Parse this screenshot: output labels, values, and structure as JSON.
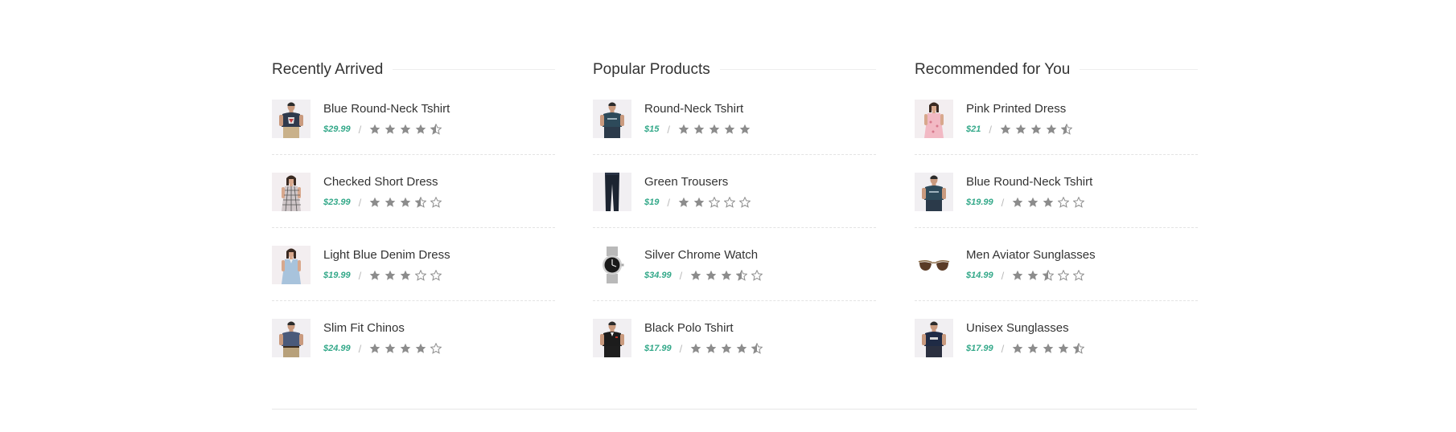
{
  "colors": {
    "accent": "#35a98a",
    "star": "#8c8c8c",
    "text": "#333333"
  },
  "columns": [
    {
      "title": "Recently Arrived",
      "items": [
        {
          "name": "Blue Round-Neck Tshirt",
          "price": "$29.99",
          "rating": 4.5,
          "thumb": "tshirt-model-image"
        },
        {
          "name": "Checked Short Dress",
          "price": "$23.99",
          "rating": 3.5,
          "thumb": "dress-model-image"
        },
        {
          "name": "Light Blue Denim Dress",
          "price": "$19.99",
          "rating": 3,
          "thumb": "denim-dress-model-image"
        },
        {
          "name": "Slim Fit Chinos",
          "price": "$24.99",
          "rating": 4,
          "thumb": "chinos-model-image"
        }
      ]
    },
    {
      "title": "Popular Products",
      "items": [
        {
          "name": "Round-Neck Tshirt",
          "price": "$15",
          "rating": 5,
          "thumb": "tshirt-model-image"
        },
        {
          "name": "Green Trousers",
          "price": "$19",
          "rating": 2,
          "thumb": "trousers-model-image"
        },
        {
          "name": "Silver Chrome Watch",
          "price": "$34.99",
          "rating": 3.5,
          "thumb": "watch-image"
        },
        {
          "name": "Black Polo Tshirt",
          "price": "$17.99",
          "rating": 4.5,
          "thumb": "polo-model-image"
        }
      ]
    },
    {
      "title": "Recommended for You",
      "items": [
        {
          "name": "Pink Printed Dress",
          "price": "$21",
          "rating": 4.5,
          "thumb": "pink-dress-model-image"
        },
        {
          "name": "Blue Round-Neck Tshirt",
          "price": "$19.99",
          "rating": 3,
          "thumb": "tshirt-model-image"
        },
        {
          "name": "Men Aviator Sunglasses",
          "price": "$14.99",
          "rating": 2.5,
          "thumb": "sunglasses-image"
        },
        {
          "name": "Unisex Sunglasses",
          "price": "$17.99",
          "rating": 4.5,
          "thumb": "tshirt-model-image"
        }
      ]
    }
  ]
}
